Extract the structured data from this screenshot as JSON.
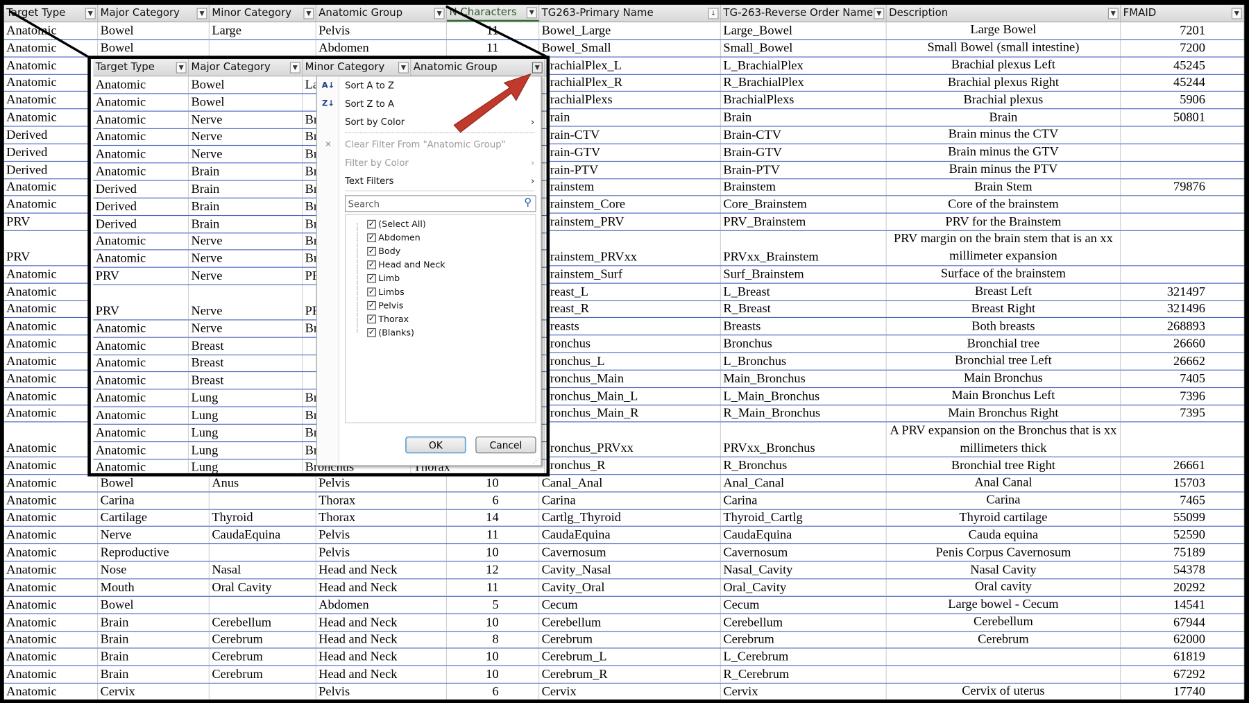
{
  "main": {
    "columns": [
      "Target Type",
      "Major Category",
      "Minor Category",
      "Anatomic Group",
      "N Characters",
      "TG263-Primary Name",
      "TG-263-Reverse Order Name",
      "Description",
      "FMAID"
    ],
    "rows": [
      [
        "Anatomic",
        "Bowel",
        "Large",
        "Pelvis",
        "11",
        "Bowel_Large",
        "Large_Bowel",
        "Large Bowel",
        "7201"
      ],
      [
        "Anatomic",
        "Bowel",
        "",
        "Abdomen",
        "11",
        "Bowel_Small",
        "Small_Bowel",
        "Small Bowel (small intestine)",
        "7200"
      ],
      [
        "Anatomic",
        "",
        "",
        "",
        "",
        "BrachialPlex_L",
        "L_BrachialPlex",
        "Brachial plexus Left",
        "45245"
      ],
      [
        "Anatomic",
        "",
        "",
        "",
        "",
        "BrachialPlex_R",
        "R_BrachialPlex",
        "Brachial plexus Right",
        "45244"
      ],
      [
        "Anatomic",
        "",
        "",
        "",
        "",
        "BrachialPlexs",
        "BrachialPlexs",
        "Brachial plexus",
        "5906"
      ],
      [
        "Anatomic",
        "",
        "",
        "",
        "",
        "Brain",
        "Brain",
        "Brain",
        "50801"
      ],
      [
        "Derived",
        "",
        "",
        "",
        "",
        "Brain-CTV",
        "Brain-CTV",
        "Brain minus the CTV",
        ""
      ],
      [
        "Derived",
        "",
        "",
        "",
        "",
        "Brain-GTV",
        "Brain-GTV",
        "Brain minus the GTV",
        ""
      ],
      [
        "Derived",
        "",
        "",
        "",
        "",
        "Brain-PTV",
        "Brain-PTV",
        "Brain minus the PTV",
        ""
      ],
      [
        "Anatomic",
        "",
        "",
        "",
        "",
        "Brainstem",
        "Brainstem",
        "Brain Stem",
        "79876"
      ],
      [
        "Anatomic",
        "",
        "",
        "",
        "",
        "Brainstem_Core",
        "Core_Brainstem",
        "Core of the brainstem",
        ""
      ],
      [
        "PRV",
        "",
        "",
        "",
        "",
        "Brainstem_PRV",
        "PRV_Brainstem",
        "PRV for the Brainstem",
        ""
      ],
      [
        "PRV",
        "",
        "",
        "",
        "",
        "Brainstem_PRVxx",
        "PRVxx_Brainstem",
        "PRV margin on the brain stem that is an xx millimeter expansion",
        ""
      ],
      [
        "Anatomic",
        "",
        "",
        "",
        "",
        "Brainstem_Surf",
        "Surf_Brainstem",
        "Surface of the brainstem",
        ""
      ],
      [
        "Anatomic",
        "",
        "",
        "",
        "",
        "Breast_L",
        "L_Breast",
        "Breast Left",
        "321497"
      ],
      [
        "Anatomic",
        "",
        "",
        "",
        "",
        "Breast_R",
        "R_Breast",
        "Breast Right",
        "321496"
      ],
      [
        "Anatomic",
        "",
        "",
        "",
        "",
        "Breasts",
        "Breasts",
        "Both breasts",
        "268893"
      ],
      [
        "Anatomic",
        "",
        "",
        "",
        "",
        "Bronchus",
        "Bronchus",
        "Bronchial tree",
        "26660"
      ],
      [
        "Anatomic",
        "",
        "",
        "",
        "",
        "Bronchus_L",
        "L_Bronchus",
        "Bronchial tree Left",
        "26662"
      ],
      [
        "Anatomic",
        "",
        "",
        "",
        "",
        "Bronchus_Main",
        "Main_Bronchus",
        "Main Bronchus",
        "7405"
      ],
      [
        "Anatomic",
        "",
        "",
        "",
        "",
        "Bronchus_Main_L",
        "L_Main_Bronchus",
        "Main Bronchus Left",
        "7396"
      ],
      [
        "Anatomic",
        "",
        "",
        "",
        "",
        "Bronchus_Main_R",
        "R_Main_Bronchus",
        "Main Bronchus Right",
        "7395"
      ],
      [
        "Anatomic",
        "",
        "",
        "",
        "",
        "Bronchus_PRVxx",
        "PRVxx_Bronchus",
        "A PRV expansion on the Bronchus that  is xx millimeters thick",
        ""
      ],
      [
        "Anatomic",
        "",
        "",
        "",
        "",
        "Bronchus_R",
        "R_Bronchus",
        "Bronchial tree Right",
        "26661"
      ],
      [
        "Anatomic",
        "Bowel",
        "Anus",
        "Pelvis",
        "10",
        "Canal_Anal",
        "Anal_Canal",
        "Anal Canal",
        "15703"
      ],
      [
        "Anatomic",
        "Carina",
        "",
        "Thorax",
        "6",
        "Carina",
        "Carina",
        "Carina",
        "7465"
      ],
      [
        "Anatomic",
        "Cartilage",
        "Thyroid",
        "Thorax",
        "14",
        "Cartlg_Thyroid",
        "Thyroid_Cartlg",
        "Thyroid cartilage",
        "55099"
      ],
      [
        "Anatomic",
        "Nerve",
        "CaudaEquina",
        "Pelvis",
        "11",
        "CaudaEquina",
        "CaudaEquina",
        "Cauda equina",
        "52590"
      ],
      [
        "Anatomic",
        "Reproductive",
        "",
        "Pelvis",
        "10",
        "Cavernosum",
        "Cavernosum",
        "Penis Corpus Cavernosum",
        "75189"
      ],
      [
        "Anatomic",
        "Nose",
        "Nasal",
        "Head and Neck",
        "12",
        "Cavity_Nasal",
        "Nasal_Cavity",
        "Nasal Cavity",
        "54378"
      ],
      [
        "Anatomic",
        "Mouth",
        "Oral Cavity",
        "Head and Neck",
        "11",
        "Cavity_Oral",
        "Oral_Cavity",
        "Oral cavity",
        "20292"
      ],
      [
        "Anatomic",
        "Bowel",
        "",
        "Abdomen",
        "5",
        "Cecum",
        "Cecum",
        "Large bowel - Cecum",
        "14541"
      ],
      [
        "Anatomic",
        "Brain",
        "Cerebellum",
        "Head and Neck",
        "10",
        "Cerebellum",
        "Cerebellum",
        "Cerebellum",
        "67944"
      ],
      [
        "Anatomic",
        "Brain",
        "Cerebrum",
        "Head and Neck",
        "8",
        "Cerebrum",
        "Cerebrum",
        "Cerebrum",
        "62000"
      ],
      [
        "Anatomic",
        "Brain",
        "Cerebrum",
        "Head and Neck",
        "10",
        "Cerebrum_L",
        "L_Cerebrum",
        "",
        "61819"
      ],
      [
        "Anatomic",
        "Brain",
        "Cerebrum",
        "Head and Neck",
        "10",
        "Cerebrum_R",
        "R_Cerebrum",
        "",
        "67292"
      ],
      [
        "Anatomic",
        "Cervix",
        "",
        "Pelvis",
        "6",
        "Cervix",
        "Cervix",
        "Cervix of uterus",
        "17740"
      ]
    ],
    "double_rows": [
      12,
      22
    ],
    "active_column": 4
  },
  "inset": {
    "columns": [
      "Target Type",
      "Major Category",
      "Minor Category",
      "Anatomic Group"
    ],
    "rows": [
      [
        "Anatomic",
        "Bowel",
        "La",
        ""
      ],
      [
        "Anatomic",
        "Bowel",
        "",
        ""
      ],
      [
        "Anatomic",
        "Nerve",
        "Br",
        ""
      ],
      [
        "Anatomic",
        "Nerve",
        "Br",
        ""
      ],
      [
        "Anatomic",
        "Nerve",
        "Br",
        ""
      ],
      [
        "Anatomic",
        "Brain",
        "Br",
        ""
      ],
      [
        "Derived",
        "Brain",
        "Br",
        ""
      ],
      [
        "Derived",
        "Brain",
        "Br",
        ""
      ],
      [
        "Derived",
        "Brain",
        "Br",
        ""
      ],
      [
        "Anatomic",
        "Nerve",
        "Br",
        ""
      ],
      [
        "Anatomic",
        "Nerve",
        "Br",
        ""
      ],
      [
        "PRV",
        "Nerve",
        "PR",
        ""
      ],
      [
        "PRV",
        "Nerve",
        "PR",
        ""
      ],
      [
        "Anatomic",
        "Nerve",
        "Br",
        ""
      ],
      [
        "Anatomic",
        "Breast",
        "",
        ""
      ],
      [
        "Anatomic",
        "Breast",
        "",
        ""
      ],
      [
        "Anatomic",
        "Breast",
        "",
        ""
      ],
      [
        "Anatomic",
        "Lung",
        "Br",
        ""
      ],
      [
        "Anatomic",
        "Lung",
        "Br",
        ""
      ],
      [
        "Anatomic",
        "Lung",
        "Br",
        ""
      ],
      [
        "Anatomic",
        "Lung",
        "Br",
        ""
      ],
      [
        "Anatomic",
        "Lung",
        "Bronchus",
        "Thorax"
      ]
    ],
    "double_rows": [
      12
    ]
  },
  "filter_menu": {
    "sort_az": "Sort A to Z",
    "sort_za": "Sort Z to A",
    "sort_by_color": "Sort by Color",
    "clear_filter": "Clear Filter From \"Anatomic Group\"",
    "filter_by_color": "Filter by Color",
    "text_filters": "Text Filters",
    "search_placeholder": "Search",
    "items": [
      "(Select All)",
      "Abdomen",
      "Body",
      "Head and Neck",
      "Limb",
      "Limbs",
      "Pelvis",
      "Thorax",
      "(Blanks)"
    ],
    "checked": [
      true,
      true,
      true,
      true,
      true,
      true,
      true,
      true,
      true
    ],
    "ok": "OK",
    "cancel": "Cancel"
  },
  "colors": {
    "row_line": "#4a66c0",
    "arrow": "#c0392b",
    "frame": "#000000"
  }
}
